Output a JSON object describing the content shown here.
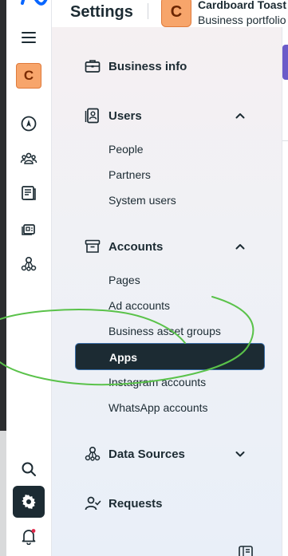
{
  "header": {
    "title": "Settings",
    "business_initial": "C",
    "business_name": "Cardboard Toast",
    "business_subtitle": "Business portfolio"
  },
  "rail": {
    "avatar_initial": "C",
    "icons": [
      "menu-icon",
      "compass-icon",
      "people-icon",
      "pages-icon",
      "catalog-icon",
      "network-icon",
      "search-icon",
      "gear-icon",
      "bell-icon"
    ]
  },
  "nav": {
    "business_info": "Business info",
    "users": {
      "label": "Users",
      "items": [
        "People",
        "Partners",
        "System users"
      ]
    },
    "accounts": {
      "label": "Accounts",
      "items": [
        "Pages",
        "Ad accounts",
        "Business asset groups",
        "Apps",
        "Instagram accounts",
        "WhatsApp accounts"
      ]
    },
    "data_sources": "Data Sources",
    "requests": "Requests"
  },
  "colors": {
    "active_bg": "#1c2b33",
    "avatar": "#f7a56b",
    "annotation": "#5ac24a"
  }
}
